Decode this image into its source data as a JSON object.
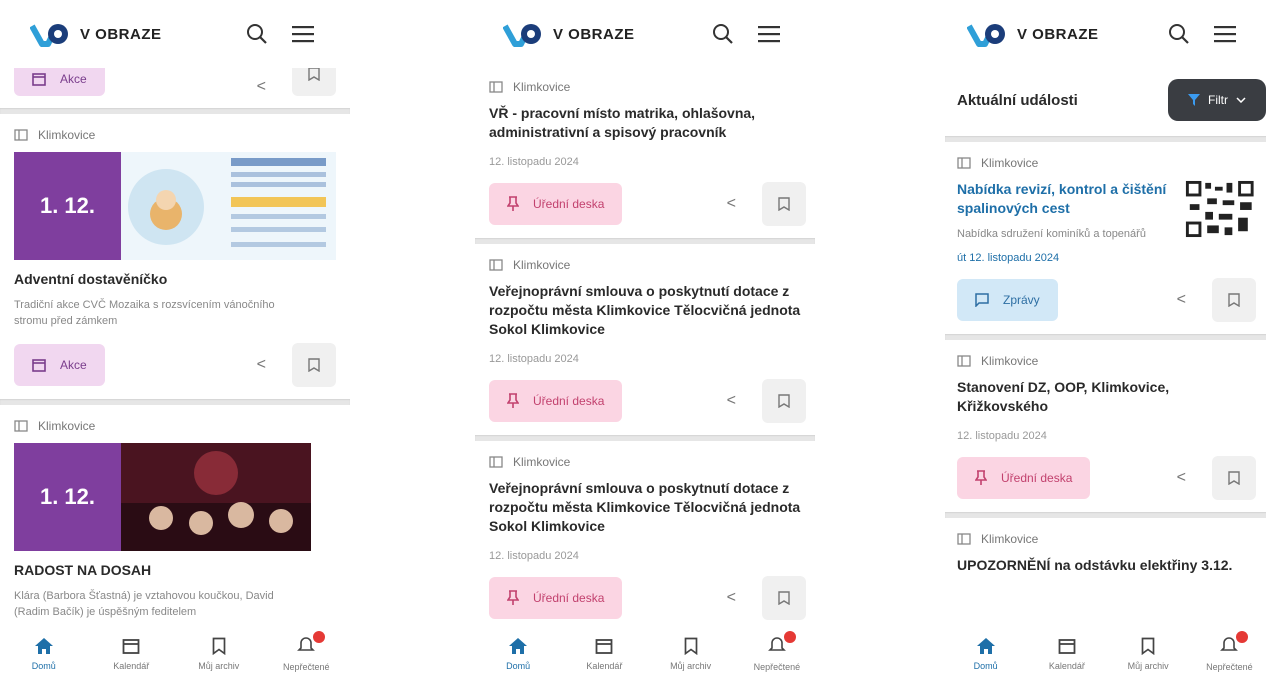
{
  "app": {
    "title": "V OBRAZE"
  },
  "nav": {
    "home": "Domů",
    "calendar": "Kalendář",
    "archive": "Můj archiv",
    "unread": "Nepřečtené"
  },
  "p1": {
    "top_badge": "Akce",
    "cards": [
      {
        "location": "Klimkovice",
        "date_box": "1. 12.",
        "title": "Adventní dostavěníčko",
        "desc": "Tradiční akce CVČ Mozaika s rozsvícením vánočního stromu před zámkem",
        "badge": "Akce"
      },
      {
        "location": "Klimkovice",
        "date_box": "1. 12.",
        "title": "RADOST NA DOSAH",
        "desc": "Klára (Barbora Šťastná) je vztahovou koučkou, David (Radim Bačík) je úspěšným feditelem"
      }
    ]
  },
  "p2": {
    "cards": [
      {
        "location": "Klimkovice",
        "title": "VŘ - pracovní místo matrika, ohlašovna, administrativní a spisový pracovník",
        "date": "12. listopadu 2024",
        "badge": "Úřední deska"
      },
      {
        "location": "Klimkovice",
        "title": "Veřejnoprávní smlouva o poskytnutí dotace z rozpočtu města Klimkovice Tělocvičná jednota Sokol Klimkovice",
        "date": "12. listopadu 2024",
        "badge": "Úřední deska"
      },
      {
        "location": "Klimkovice",
        "title": "Veřejnoprávní smlouva o poskytnutí dotace z rozpočtu města Klimkovice Tělocvičná jednota Sokol Klimkovice",
        "date": "12. listopadu 2024",
        "badge": "Úřední deska"
      }
    ]
  },
  "p3": {
    "section_title": "Aktuální události",
    "filter_label": "Filtr",
    "cards": [
      {
        "location": "Klimkovice",
        "title": "Nabídka revizí, kontrol a čištění spalinových cest",
        "desc": "Nabídka sdružení kominíků a topenářů",
        "date": "út 12. listopadu 2024",
        "badge": "Zprávy"
      },
      {
        "location": "Klimkovice",
        "title": "Stanovení DZ, OOP, Klimkovice, Křižkovského",
        "date": "12. listopadu 2024",
        "badge": "Úřední deska"
      },
      {
        "location": "Klimkovice",
        "title": "UPOZORNĚNÍ na odstávku elektřiny 3.12."
      }
    ]
  },
  "colors": {
    "accent": "#1e6fa8",
    "purple": "#7f3e9e",
    "badge_red": "#e53935"
  }
}
